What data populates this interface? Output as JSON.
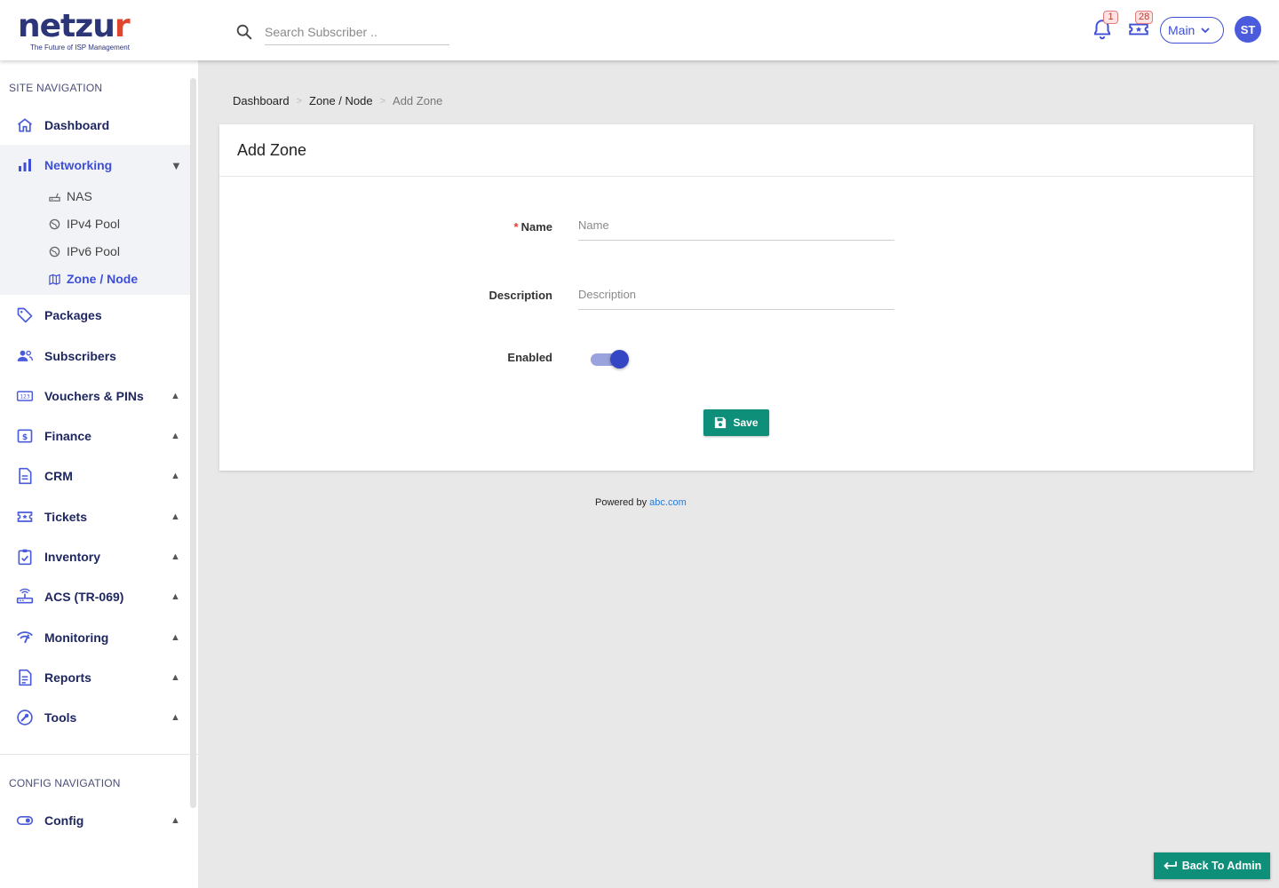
{
  "brand": {
    "logo_main": "netzu",
    "logo_r": "r",
    "tagline": "The Future of ISP Management"
  },
  "header": {
    "search_placeholder": "Search Subscriber ..",
    "notifications_count": "1",
    "tickets_count": "28",
    "workspace": "Main",
    "avatar_initials": "ST"
  },
  "sidebar": {
    "site_heading": "SITE NAVIGATION",
    "config_heading": "CONFIG NAVIGATION",
    "items": [
      {
        "label": "Dashboard",
        "icon": "home-icon"
      },
      {
        "label": "Networking",
        "icon": "bar-chart-icon"
      },
      {
        "label": "Packages",
        "icon": "tag-icon"
      },
      {
        "label": "Subscribers",
        "icon": "users-icon"
      },
      {
        "label": "Vouchers & PINs",
        "icon": "numbers-icon"
      },
      {
        "label": "Finance",
        "icon": "dollar-icon"
      },
      {
        "label": "CRM",
        "icon": "document-icon"
      },
      {
        "label": "Tickets",
        "icon": "ticket-icon"
      },
      {
        "label": "Inventory",
        "icon": "clipboard-check-icon"
      },
      {
        "label": "ACS (TR-069)",
        "icon": "router-icon"
      },
      {
        "label": "Monitoring",
        "icon": "signal-icon"
      },
      {
        "label": "Reports",
        "icon": "report-icon"
      },
      {
        "label": "Tools",
        "icon": "wrench-icon"
      },
      {
        "label": "Config",
        "icon": "toggle-icon"
      }
    ],
    "networking_sub": [
      {
        "label": "NAS",
        "icon": "router-small-icon"
      },
      {
        "label": "IPv4 Pool",
        "icon": "globe-icon"
      },
      {
        "label": "IPv6 Pool",
        "icon": "globe-icon"
      },
      {
        "label": "Zone / Node",
        "icon": "map-icon"
      }
    ]
  },
  "breadcrumb": {
    "item1": "Dashboard",
    "item2": "Zone / Node",
    "current": "Add Zone",
    "separator": ">"
  },
  "form": {
    "title": "Add Zone",
    "required_mark": "*",
    "name_label": "Name",
    "name_placeholder": "Name",
    "description_label": "Description",
    "description_placeholder": "Description",
    "enabled_label": "Enabled",
    "enabled": true,
    "save_label": "Save"
  },
  "footer": {
    "powered_by": "Powered by",
    "link": "abc.com"
  },
  "back_button": "Back To Admin",
  "colors": {
    "primary": "#3d4fd6",
    "navy": "#1f2761",
    "teal": "#0d8f7a",
    "logo_accent": "#e0452e"
  }
}
